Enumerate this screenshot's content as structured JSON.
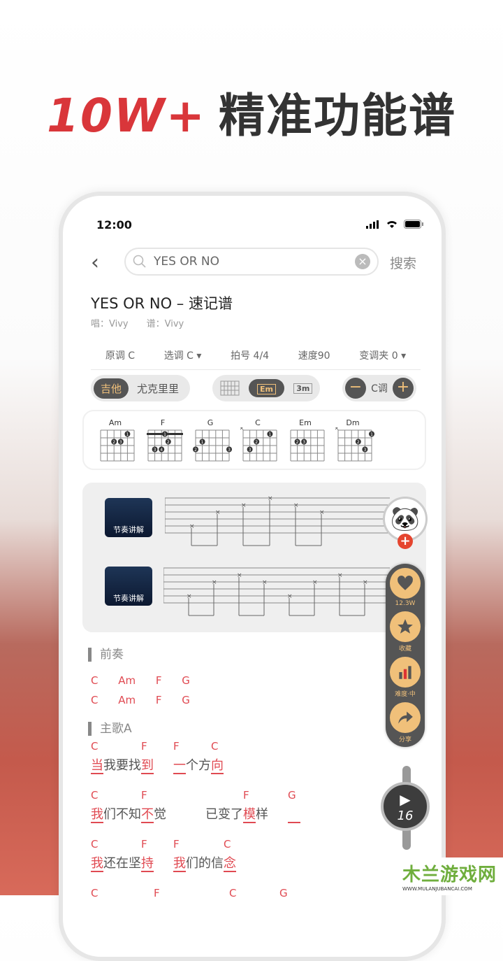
{
  "headline": {
    "number": "10W+",
    "text": "精准功能谱"
  },
  "status": {
    "time": "12:00"
  },
  "search": {
    "value": "YES OR NO",
    "button": "搜索"
  },
  "song": {
    "title": "YES OR NO – 速记谱",
    "singer": "唱：Vivy",
    "tab_by": "谱：Vivy"
  },
  "params": [
    "原调 C",
    "选调 C ▾",
    "拍号 4/4",
    "速度90",
    "变调夹 0 ▾"
  ],
  "instrument": {
    "active": "吉他",
    "other": "尤克里里"
  },
  "display_modes": {
    "active": "Em",
    "other": "3m"
  },
  "key": {
    "label": "C调",
    "minus": "−",
    "plus": "+"
  },
  "chords": [
    {
      "name": "Am",
      "muted": [],
      "barre": false,
      "dots": [
        [
          4,
          1,
          1
        ],
        [
          2,
          2,
          2
        ],
        [
          3,
          2,
          3
        ]
      ]
    },
    {
      "name": "F",
      "muted": [],
      "barre": true,
      "dots": [
        [
          3,
          2,
          2
        ],
        [
          1,
          3,
          3
        ],
        [
          2,
          3,
          4
        ]
      ]
    },
    {
      "name": "G",
      "muted": [],
      "barre": false,
      "dots": [
        [
          1,
          2,
          1
        ],
        [
          0,
          3,
          2
        ],
        [
          5,
          3,
          3
        ]
      ]
    },
    {
      "name": "C",
      "muted": [
        0
      ],
      "barre": false,
      "dots": [
        [
          4,
          1,
          1
        ],
        [
          2,
          2,
          2
        ],
        [
          1,
          3,
          3
        ]
      ]
    },
    {
      "name": "Em",
      "muted": [],
      "barre": false,
      "dots": [
        [
          1,
          2,
          2
        ],
        [
          2,
          2,
          3
        ]
      ]
    },
    {
      "name": "Dm",
      "muted": [
        0
      ],
      "barre": false,
      "dots": [
        [
          5,
          1,
          1
        ],
        [
          3,
          2,
          2
        ],
        [
          4,
          3,
          3
        ]
      ]
    }
  ],
  "rhythm": [
    {
      "label": "节奏讲解"
    },
    {
      "label": "节奏讲解"
    }
  ],
  "sections": {
    "intro": "前奏",
    "verse": "主歌A"
  },
  "intro_rows": [
    "C Am F G",
    "C Am F G"
  ],
  "lyrics": [
    [
      {
        "c": "C",
        "t": "当",
        "u": true
      },
      {
        "t": "我要找"
      },
      {
        "c": "F",
        "t": "到",
        "u": true
      },
      {
        "gap": true
      },
      {
        "c": "F",
        "t": "一",
        "u": true
      },
      {
        "t": "个方"
      },
      {
        "c": "C",
        "t": "向",
        "u": true
      }
    ],
    [
      {
        "c": "C",
        "t": "我",
        "u": true
      },
      {
        "t": "们不知"
      },
      {
        "c": "F",
        "t": "不",
        "u": true
      },
      {
        "t": "觉"
      },
      {
        "gap": true
      },
      {
        "gap": true
      },
      {
        "t": "已变了"
      },
      {
        "c": "F",
        "t": "模",
        "u": true
      },
      {
        "t": "样"
      },
      {
        "gap": true
      },
      {
        "c": "G",
        "t": "　",
        "u": true
      }
    ],
    [
      {
        "c": "C",
        "t": "我",
        "u": true
      },
      {
        "t": "还在坚"
      },
      {
        "c": "F",
        "t": "持",
        "u": true
      },
      {
        "gap": true
      },
      {
        "c": "F",
        "t": "我",
        "u": true
      },
      {
        "t": "们的信"
      },
      {
        "c": "C",
        "t": "念",
        "u": true
      }
    ],
    [
      {
        "c": "C",
        "t": "　"
      },
      {
        "t": "　　　　"
      },
      {
        "c": "F",
        "t": "　"
      },
      {
        "t": "　　　　　"
      },
      {
        "c": "C",
        "t": "　"
      },
      {
        "t": "　　　"
      },
      {
        "c": "G",
        "t": "　"
      }
    ]
  ],
  "side_actions": [
    {
      "icon": "heart-icon",
      "label": "12.3W"
    },
    {
      "icon": "star-icon",
      "label": "收藏"
    },
    {
      "icon": "difficulty-icon",
      "label": "难度·中"
    },
    {
      "icon": "share-icon",
      "label": "分享"
    }
  ],
  "play": {
    "count": "16"
  },
  "watermark": {
    "name": "木兰游戏网",
    "url": "WWW.MULANJUBANCAI.COM"
  },
  "colors": {
    "accent": "#e04a52",
    "gold": "#f0c07a",
    "dark": "#555555",
    "headline_red": "#d9363a"
  }
}
